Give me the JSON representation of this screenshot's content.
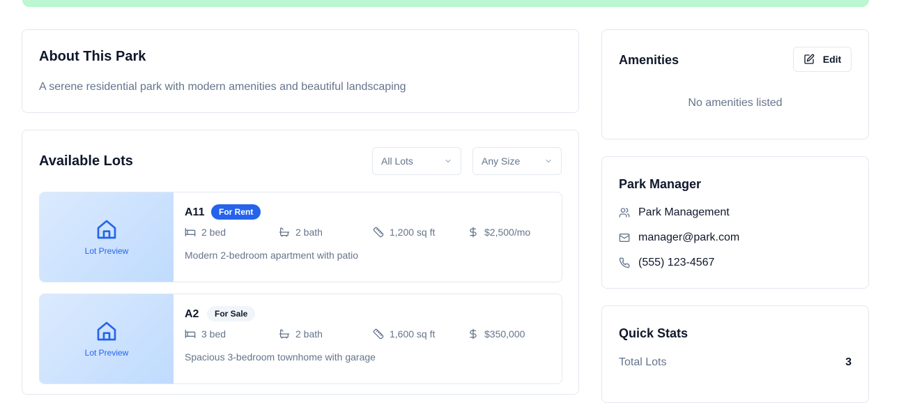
{
  "about": {
    "title": "About This Park",
    "description": "A serene residential park with modern amenities and beautiful landscaping"
  },
  "lots": {
    "title": "Available Lots",
    "filter_lots": "All Lots",
    "filter_size": "Any Size",
    "items": [
      {
        "name": "A11",
        "badge": "For Rent",
        "bed": "2 bed",
        "bath": "2 bath",
        "size": "1,200 sq ft",
        "price": "$2,500/mo",
        "description": "Modern 2-bedroom apartment with patio",
        "preview_label": "Lot Preview"
      },
      {
        "name": "A2",
        "badge": "For Sale",
        "bed": "3 bed",
        "bath": "2 bath",
        "size": "1,600 sq ft",
        "price": "$350,000",
        "description": "Spacious 3-bedroom townhome with garage",
        "preview_label": "Lot Preview"
      }
    ]
  },
  "amenities": {
    "title": "Amenities",
    "edit_label": "Edit",
    "empty": "No amenities listed"
  },
  "manager": {
    "title": "Park Manager",
    "name": "Park Management",
    "email": "manager@park.com",
    "phone": "(555) 123-4567"
  },
  "stats": {
    "title": "Quick Stats",
    "total_lots_label": "Total Lots",
    "total_lots_value": "3"
  },
  "colors": {
    "accent": "#2563eb",
    "banner": "#bbf7d0",
    "muted_text": "#64748b"
  }
}
